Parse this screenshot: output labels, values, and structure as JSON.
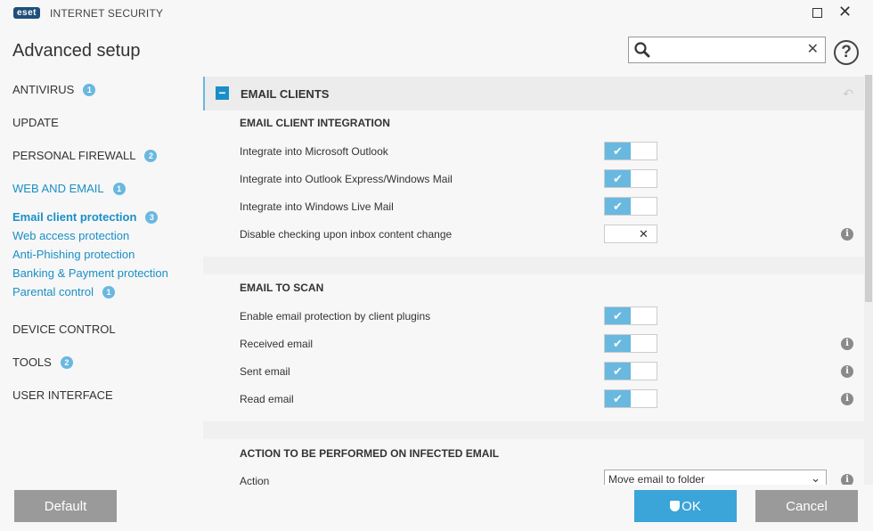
{
  "app": {
    "logo_text": "eset",
    "product_name": "INTERNET SECURITY",
    "window_title": "Advanced setup"
  },
  "search": {
    "value": "",
    "placeholder": ""
  },
  "sidebar": {
    "items": [
      {
        "label": "ANTIVIRUS",
        "badge": "1"
      },
      {
        "label": "UPDATE",
        "badge": ""
      },
      {
        "label": "PERSONAL FIREWALL",
        "badge": "2"
      },
      {
        "label": "WEB AND EMAIL",
        "badge": "1"
      },
      {
        "label": "Email client protection",
        "badge": "3"
      },
      {
        "label": "Web access protection",
        "badge": ""
      },
      {
        "label": "Anti-Phishing protection",
        "badge": ""
      },
      {
        "label": "Banking & Payment protection",
        "badge": ""
      },
      {
        "label": "Parental control",
        "badge": "1"
      },
      {
        "label": "DEVICE CONTROL",
        "badge": ""
      },
      {
        "label": "TOOLS",
        "badge": "2"
      },
      {
        "label": "USER INTERFACE",
        "badge": ""
      }
    ]
  },
  "main": {
    "section_title": "EMAIL CLIENTS",
    "groups": [
      {
        "title": "EMAIL CLIENT INTEGRATION",
        "rows": [
          {
            "label": "Integrate into Microsoft Outlook",
            "enabled": true,
            "info": false
          },
          {
            "label": "Integrate into Outlook Express/Windows Mail",
            "enabled": true,
            "info": false
          },
          {
            "label": "Integrate into Windows Live Mail",
            "enabled": true,
            "info": false
          },
          {
            "label": "Disable checking upon inbox content change",
            "enabled": false,
            "info": true
          }
        ]
      },
      {
        "title": "EMAIL TO SCAN",
        "rows": [
          {
            "label": "Enable email protection by client plugins",
            "enabled": true,
            "info": false
          },
          {
            "label": "Received email",
            "enabled": true,
            "info": true
          },
          {
            "label": "Sent email",
            "enabled": true,
            "info": true
          },
          {
            "label": "Read email",
            "enabled": true,
            "info": true
          }
        ]
      },
      {
        "title": "ACTION TO BE PERFORMED ON INFECTED EMAIL",
        "rows": [
          {
            "label": "Action",
            "select_value": "Move email to folder",
            "info": true
          }
        ]
      }
    ]
  },
  "footer": {
    "default_label": "Default",
    "ok_label": "OK",
    "cancel_label": "Cancel"
  },
  "glyphs": {
    "check": "✔",
    "cross": "✕",
    "info": "i",
    "help": "?",
    "close": "✕",
    "minus": "−",
    "chevron": "⌄",
    "revert": "↶"
  },
  "colors": {
    "accent": "#1a8fc6",
    "toggle_on": "#69b8e0",
    "button_gray": "#9a9a9a",
    "ok_blue": "#3ba4d9"
  }
}
